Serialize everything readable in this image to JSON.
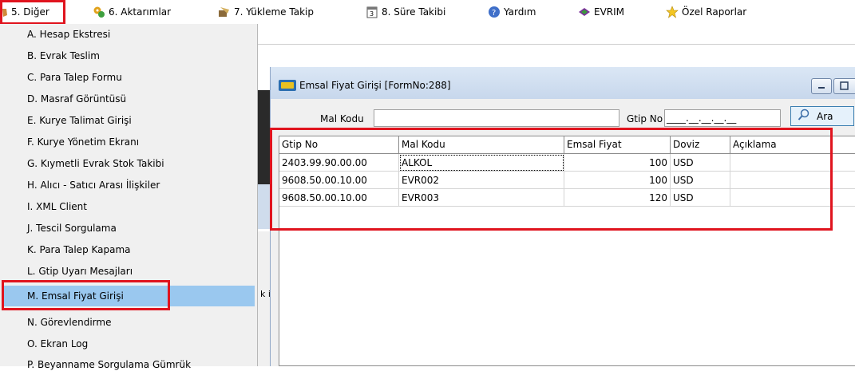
{
  "menubar": {
    "items": [
      {
        "label": "5. Diğer",
        "icon": "hand-icon"
      },
      {
        "label": "6.  Aktarımlar",
        "icon": "gears-icon"
      },
      {
        "label": "7.  Yükleme Takip",
        "icon": "tracking-icon"
      },
      {
        "label": "8. Süre Takibi",
        "icon": "calendar-icon"
      },
      {
        "label": "Yardım",
        "icon": "help-icon"
      },
      {
        "label": "EVRIM",
        "icon": "evrim-icon"
      },
      {
        "label": "Özel Raporlar",
        "icon": "star-icon"
      }
    ]
  },
  "dropdown": {
    "items": [
      "A. Hesap Ekstresi",
      "B. Evrak Teslim",
      "C. Para Talep Formu",
      "D. Masraf Görüntüsü",
      "E. Kurye Talimat Girişi",
      "F. Kurye Yönetim Ekranı",
      "G. Kıymetli Evrak Stok Takibi",
      "H. Alıcı - Satıcı Arası İlişkiler",
      "I. XML Client",
      "J. Tescil Sorgulama",
      "K. Para Talep Kapama",
      "L. Gtip Uyarı Mesajları",
      "M. Emsal Fiyat Girişi",
      "N. Görevlendirme",
      "O. Ekran Log",
      "P. Beyanname Sorgulama Gümrük"
    ],
    "selected_index": 12
  },
  "background": {
    "partial_text": "k i"
  },
  "window": {
    "title": "Emsal Fiyat Girişi [FormNo:288]",
    "mal_kodu_label": "Mal Kodu",
    "mal_kodu_value": "",
    "gtip_no_label": "Gtip No",
    "gtip_no_mask": "____.__.__.__.__",
    "search_button": "Ara"
  },
  "grid": {
    "columns": [
      "Gtip No",
      "Mal Kodu",
      "Emsal Fiyat",
      "Doviz",
      "Açıklama"
    ],
    "rows": [
      [
        "2403.99.90.00.00",
        "ALKOL",
        "100",
        "USD",
        ""
      ],
      [
        "9608.50.00.10.00",
        "EVR002",
        "100",
        "USD",
        ""
      ],
      [
        "9608.50.00.10.00",
        "EVR003",
        "120",
        "USD",
        ""
      ]
    ]
  },
  "colors": {
    "highlight_red": "#e0141e",
    "selection_blue": "#9ac8ef",
    "titlebar": "#dbe7f5"
  }
}
